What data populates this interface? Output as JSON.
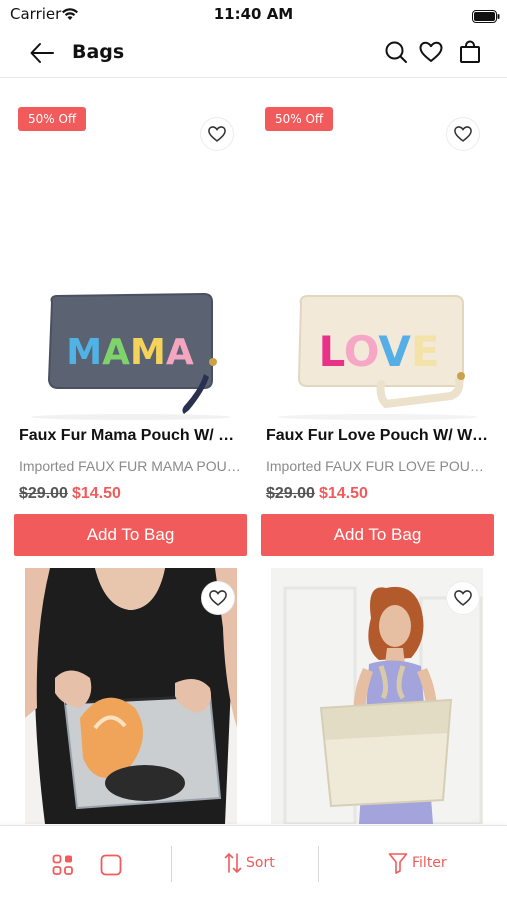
{
  "status_bar": {
    "carrier": "Carrier",
    "time": "11:40 AM"
  },
  "header": {
    "title": "Bags",
    "icons": [
      "back-arrow-icon",
      "search-icon",
      "heart-icon",
      "shopping-bag-icon"
    ]
  },
  "colors": {
    "accent": "#f15b5b",
    "price_old": "#555555",
    "desc_gray": "#8a8a8a"
  },
  "products": [
    {
      "badge": "50% Off",
      "name": "Faux Fur Mama Pouch W/ Wristlet",
      "description": "Imported FAUX FUR MAMA POUCH W/ WRISTLET",
      "old_price": "$29.00",
      "new_price": "$14.50",
      "button": "Add To Bag",
      "image_text": "MAMA"
    },
    {
      "badge": "50% Off",
      "name": "Faux Fur Love Pouch W/ Wristlet",
      "description": "Imported FAUX FUR LOVE POUCH W/ WRISTLET",
      "old_price": "$29.00",
      "new_price": "$14.50",
      "button": "Add To Bag",
      "image_text": "LOVE"
    },
    {
      "image_desc": "clear-pouch-photo"
    },
    {
      "image_desc": "woven-tote-photo"
    }
  ],
  "bottom_bar": {
    "sort_label": "Sort",
    "filter_label": "Filter"
  }
}
